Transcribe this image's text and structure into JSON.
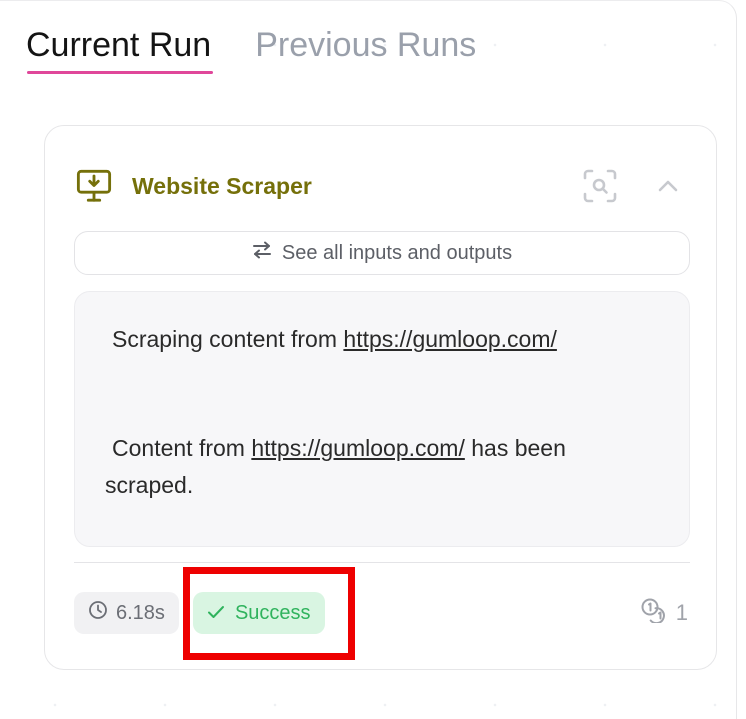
{
  "tabs": [
    {
      "label": "Current Run",
      "active": true
    },
    {
      "label": "Previous Runs",
      "active": false
    }
  ],
  "node": {
    "title": "Website Scraper",
    "icon": "monitor-download-icon",
    "title_color": "#75700a"
  },
  "header_actions": {
    "inspect_icon": "scan-search-icon",
    "collapse_icon": "chevron-up-icon"
  },
  "io_button": {
    "icon": "swap-arrows-icon",
    "label": "See all inputs and outputs"
  },
  "log": {
    "line1_prefix": "Scraping content from ",
    "line1_link": "https://gumloop.com/",
    "line2_prefix": "Content from ",
    "line2_link": "https://gumloop.com/",
    "line2_suffix": " has been scraped."
  },
  "footer": {
    "time_icon": "clock-icon",
    "duration": "6.18s",
    "status_icon": "check-icon",
    "status": "Success",
    "status_color": "#2fb35d",
    "count_icon": "coins-icon",
    "count": "1"
  },
  "colors": {
    "accent_underline": "#e0479a",
    "highlight_box": "#ee0000"
  }
}
